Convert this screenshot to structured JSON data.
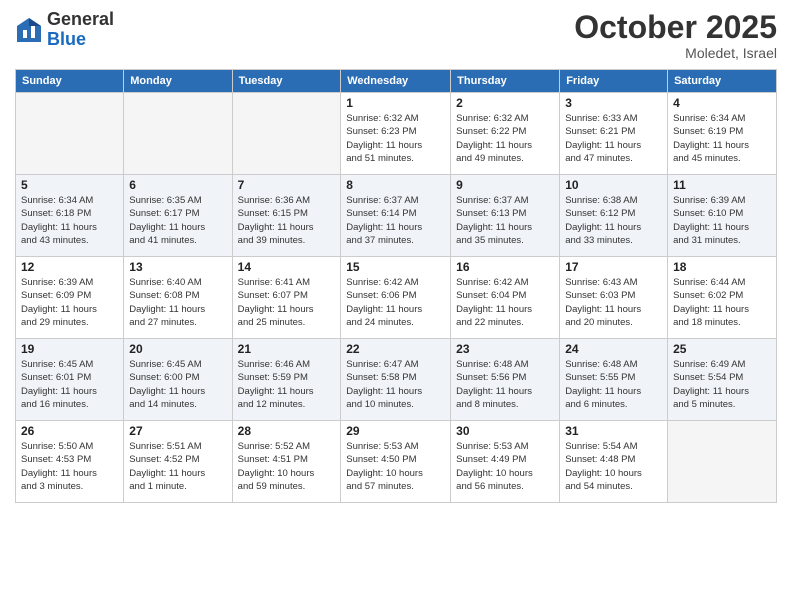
{
  "header": {
    "logo_general": "General",
    "logo_blue": "Blue",
    "month": "October 2025",
    "location": "Moledet, Israel"
  },
  "weekdays": [
    "Sunday",
    "Monday",
    "Tuesday",
    "Wednesday",
    "Thursday",
    "Friday",
    "Saturday"
  ],
  "rows": [
    [
      {
        "day": "",
        "info": ""
      },
      {
        "day": "",
        "info": ""
      },
      {
        "day": "",
        "info": ""
      },
      {
        "day": "1",
        "info": "Sunrise: 6:32 AM\nSunset: 6:23 PM\nDaylight: 11 hours\nand 51 minutes."
      },
      {
        "day": "2",
        "info": "Sunrise: 6:32 AM\nSunset: 6:22 PM\nDaylight: 11 hours\nand 49 minutes."
      },
      {
        "day": "3",
        "info": "Sunrise: 6:33 AM\nSunset: 6:21 PM\nDaylight: 11 hours\nand 47 minutes."
      },
      {
        "day": "4",
        "info": "Sunrise: 6:34 AM\nSunset: 6:19 PM\nDaylight: 11 hours\nand 45 minutes."
      }
    ],
    [
      {
        "day": "5",
        "info": "Sunrise: 6:34 AM\nSunset: 6:18 PM\nDaylight: 11 hours\nand 43 minutes."
      },
      {
        "day": "6",
        "info": "Sunrise: 6:35 AM\nSunset: 6:17 PM\nDaylight: 11 hours\nand 41 minutes."
      },
      {
        "day": "7",
        "info": "Sunrise: 6:36 AM\nSunset: 6:15 PM\nDaylight: 11 hours\nand 39 minutes."
      },
      {
        "day": "8",
        "info": "Sunrise: 6:37 AM\nSunset: 6:14 PM\nDaylight: 11 hours\nand 37 minutes."
      },
      {
        "day": "9",
        "info": "Sunrise: 6:37 AM\nSunset: 6:13 PM\nDaylight: 11 hours\nand 35 minutes."
      },
      {
        "day": "10",
        "info": "Sunrise: 6:38 AM\nSunset: 6:12 PM\nDaylight: 11 hours\nand 33 minutes."
      },
      {
        "day": "11",
        "info": "Sunrise: 6:39 AM\nSunset: 6:10 PM\nDaylight: 11 hours\nand 31 minutes."
      }
    ],
    [
      {
        "day": "12",
        "info": "Sunrise: 6:39 AM\nSunset: 6:09 PM\nDaylight: 11 hours\nand 29 minutes."
      },
      {
        "day": "13",
        "info": "Sunrise: 6:40 AM\nSunset: 6:08 PM\nDaylight: 11 hours\nand 27 minutes."
      },
      {
        "day": "14",
        "info": "Sunrise: 6:41 AM\nSunset: 6:07 PM\nDaylight: 11 hours\nand 25 minutes."
      },
      {
        "day": "15",
        "info": "Sunrise: 6:42 AM\nSunset: 6:06 PM\nDaylight: 11 hours\nand 24 minutes."
      },
      {
        "day": "16",
        "info": "Sunrise: 6:42 AM\nSunset: 6:04 PM\nDaylight: 11 hours\nand 22 minutes."
      },
      {
        "day": "17",
        "info": "Sunrise: 6:43 AM\nSunset: 6:03 PM\nDaylight: 11 hours\nand 20 minutes."
      },
      {
        "day": "18",
        "info": "Sunrise: 6:44 AM\nSunset: 6:02 PM\nDaylight: 11 hours\nand 18 minutes."
      }
    ],
    [
      {
        "day": "19",
        "info": "Sunrise: 6:45 AM\nSunset: 6:01 PM\nDaylight: 11 hours\nand 16 minutes."
      },
      {
        "day": "20",
        "info": "Sunrise: 6:45 AM\nSunset: 6:00 PM\nDaylight: 11 hours\nand 14 minutes."
      },
      {
        "day": "21",
        "info": "Sunrise: 6:46 AM\nSunset: 5:59 PM\nDaylight: 11 hours\nand 12 minutes."
      },
      {
        "day": "22",
        "info": "Sunrise: 6:47 AM\nSunset: 5:58 PM\nDaylight: 11 hours\nand 10 minutes."
      },
      {
        "day": "23",
        "info": "Sunrise: 6:48 AM\nSunset: 5:56 PM\nDaylight: 11 hours\nand 8 minutes."
      },
      {
        "day": "24",
        "info": "Sunrise: 6:48 AM\nSunset: 5:55 PM\nDaylight: 11 hours\nand 6 minutes."
      },
      {
        "day": "25",
        "info": "Sunrise: 6:49 AM\nSunset: 5:54 PM\nDaylight: 11 hours\nand 5 minutes."
      }
    ],
    [
      {
        "day": "26",
        "info": "Sunrise: 5:50 AM\nSunset: 4:53 PM\nDaylight: 11 hours\nand 3 minutes."
      },
      {
        "day": "27",
        "info": "Sunrise: 5:51 AM\nSunset: 4:52 PM\nDaylight: 11 hours\nand 1 minute."
      },
      {
        "day": "28",
        "info": "Sunrise: 5:52 AM\nSunset: 4:51 PM\nDaylight: 10 hours\nand 59 minutes."
      },
      {
        "day": "29",
        "info": "Sunrise: 5:53 AM\nSunset: 4:50 PM\nDaylight: 10 hours\nand 57 minutes."
      },
      {
        "day": "30",
        "info": "Sunrise: 5:53 AM\nSunset: 4:49 PM\nDaylight: 10 hours\nand 56 minutes."
      },
      {
        "day": "31",
        "info": "Sunrise: 5:54 AM\nSunset: 4:48 PM\nDaylight: 10 hours\nand 54 minutes."
      },
      {
        "day": "",
        "info": ""
      }
    ]
  ]
}
